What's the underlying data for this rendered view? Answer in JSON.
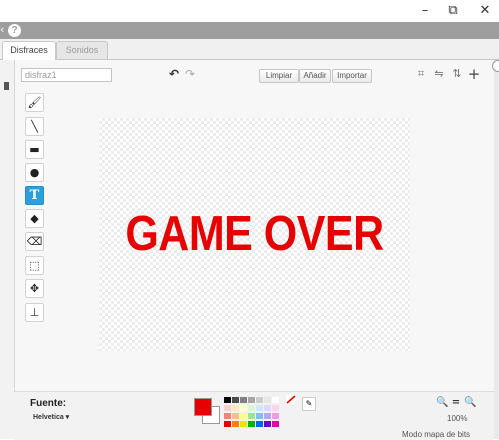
{
  "window": {
    "minimize": "–",
    "restore": "⧉",
    "close": "✕"
  },
  "appbar": {
    "left_glyph": "‹",
    "help": "?"
  },
  "tabs": [
    {
      "label": "Disfraces"
    },
    {
      "label": "Sonidos"
    }
  ],
  "costume_name": "disfraz1",
  "toolbar": {
    "undo": "↶",
    "redo": "↷",
    "clear": "Limpiar",
    "add": "Añadir",
    "import": "Importar",
    "crop": "⌗",
    "flip_h": "⇋",
    "flip_v": "⇅",
    "center": "+"
  },
  "tools": [
    {
      "name": "brush",
      "glyph": "🖌"
    },
    {
      "name": "line",
      "glyph": "╲"
    },
    {
      "name": "rectangle",
      "glyph": "▬"
    },
    {
      "name": "ellipse",
      "glyph": "●"
    },
    {
      "name": "text",
      "glyph": "T"
    },
    {
      "name": "fill",
      "glyph": "◆"
    },
    {
      "name": "eraser",
      "glyph": "⌫"
    },
    {
      "name": "select",
      "glyph": "⬚"
    },
    {
      "name": "select-remove",
      "glyph": "✥"
    },
    {
      "name": "stamp",
      "glyph": "⊥"
    }
  ],
  "canvas_text": "GAME OVER",
  "font": {
    "label": "Fuente:",
    "value": "Helvetica ▾"
  },
  "colors": {
    "selected": "#e60000",
    "palette_rows": [
      [
        "#000000",
        "#4c4c4c",
        "#808080",
        "#a6a6a6",
        "#cccccc",
        "#e6e6e6",
        "#ffffff"
      ],
      [
        "#ffd0d0",
        "#ffe6cc",
        "#ffffcc",
        "#d9f7d9",
        "#d0e8ff",
        "#e0d8ff",
        "#ffd6f0"
      ],
      [
        "#ff8080",
        "#ffbf80",
        "#ffff80",
        "#99e699",
        "#80bfff",
        "#b3a6ff",
        "#ff99dd"
      ],
      [
        "#e60000",
        "#ff8000",
        "#e6e600",
        "#00b300",
        "#0066ff",
        "#6600cc",
        "#e600a6"
      ]
    ]
  },
  "zoom": {
    "out": "🔍−",
    "reset": "=",
    "in": "🔍+",
    "level": "100%"
  },
  "mode_text": "Modo mapa de bits"
}
